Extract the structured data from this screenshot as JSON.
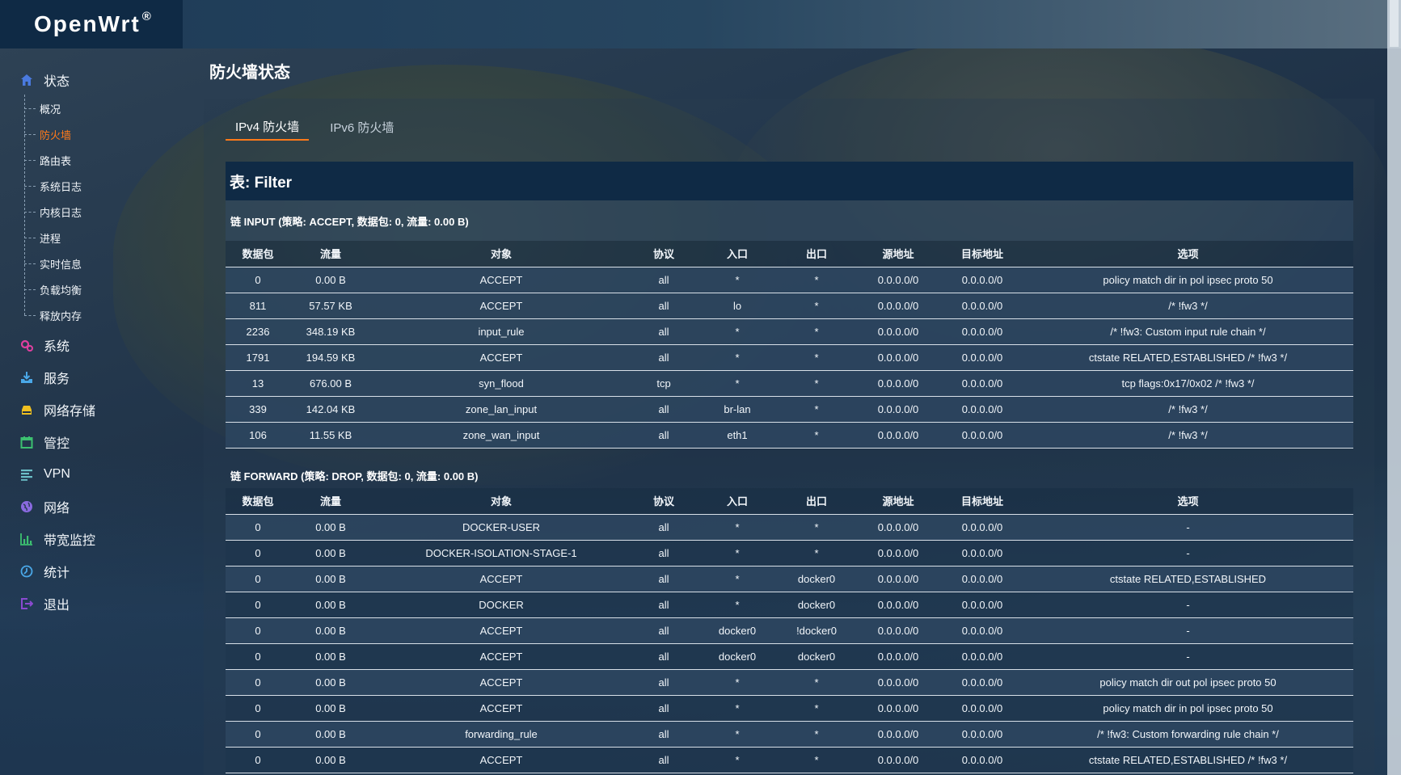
{
  "brand": {
    "name": "OpenWrt",
    "mark": "®"
  },
  "sidebar": {
    "status": {
      "label": "状态",
      "icon": "home-icon"
    },
    "status_items": [
      {
        "label": "概况",
        "active": false
      },
      {
        "label": "防火墙",
        "active": true
      },
      {
        "label": "路由表",
        "active": false
      },
      {
        "label": "系统日志",
        "active": false
      },
      {
        "label": "内核日志",
        "active": false
      },
      {
        "label": "进程",
        "active": false
      },
      {
        "label": "实时信息",
        "active": false
      },
      {
        "label": "负载均衡",
        "active": false
      },
      {
        "label": "释放内存",
        "active": false
      }
    ],
    "menus": [
      {
        "label": "系统",
        "icon": "gears-icon",
        "color": "#e040a0"
      },
      {
        "label": "服务",
        "icon": "download-tray-icon",
        "color": "#4aa8e8"
      },
      {
        "label": "网络存储",
        "icon": "disk-icon",
        "color": "#f0c020"
      },
      {
        "label": "管控",
        "icon": "calendar-icon",
        "color": "#3cc070"
      },
      {
        "label": "VPN",
        "icon": "list-icon",
        "color": "#6cc0c8"
      },
      {
        "label": "网络",
        "icon": "globe-icon",
        "color": "#8a6ae0"
      },
      {
        "label": "带宽监控",
        "icon": "bar-chart-icon",
        "color": "#3cc070"
      },
      {
        "label": "统计",
        "icon": "clock-icon",
        "color": "#4aa8e8"
      },
      {
        "label": "退出",
        "icon": "logout-icon",
        "color": "#8a4ad0"
      }
    ]
  },
  "page": {
    "title": "防火墙状态",
    "tabs": [
      {
        "label": "IPv4 防火墙",
        "active": true
      },
      {
        "label": "IPv6 防火墙",
        "active": false
      }
    ],
    "table_title": "表: Filter"
  },
  "columns": [
    "数据包",
    "流量",
    "对象",
    "协议",
    "入口",
    "出口",
    "源地址",
    "目标地址",
    "选项"
  ],
  "chains": [
    {
      "title": "链 INPUT (策略: ACCEPT, 数据包: 0, 流量: 0.00 B)",
      "rows": [
        [
          "0",
          "0.00 B",
          "ACCEPT",
          "all",
          "*",
          "*",
          "0.0.0.0/0",
          "0.0.0.0/0",
          "policy match dir in pol ipsec proto 50"
        ],
        [
          "811",
          "57.57 KB",
          "ACCEPT",
          "all",
          "lo",
          "*",
          "0.0.0.0/0",
          "0.0.0.0/0",
          "/* !fw3 */"
        ],
        [
          "2236",
          "348.19 KB",
          "input_rule",
          "all",
          "*",
          "*",
          "0.0.0.0/0",
          "0.0.0.0/0",
          "/* !fw3: Custom input rule chain */"
        ],
        [
          "1791",
          "194.59 KB",
          "ACCEPT",
          "all",
          "*",
          "*",
          "0.0.0.0/0",
          "0.0.0.0/0",
          "ctstate RELATED,ESTABLISHED /* !fw3 */"
        ],
        [
          "13",
          "676.00 B",
          "syn_flood",
          "tcp",
          "*",
          "*",
          "0.0.0.0/0",
          "0.0.0.0/0",
          "tcp flags:0x17/0x02 /* !fw3 */"
        ],
        [
          "339",
          "142.04 KB",
          "zone_lan_input",
          "all",
          "br-lan",
          "*",
          "0.0.0.0/0",
          "0.0.0.0/0",
          "/* !fw3 */"
        ],
        [
          "106",
          "11.55 KB",
          "zone_wan_input",
          "all",
          "eth1",
          "*",
          "0.0.0.0/0",
          "0.0.0.0/0",
          "/* !fw3 */"
        ]
      ]
    },
    {
      "title": "链 FORWARD (策略: DROP, 数据包: 0, 流量: 0.00 B)",
      "rows": [
        [
          "0",
          "0.00 B",
          "DOCKER-USER",
          "all",
          "*",
          "*",
          "0.0.0.0/0",
          "0.0.0.0/0",
          "-"
        ],
        [
          "0",
          "0.00 B",
          "DOCKER-ISOLATION-STAGE-1",
          "all",
          "*",
          "*",
          "0.0.0.0/0",
          "0.0.0.0/0",
          "-"
        ],
        [
          "0",
          "0.00 B",
          "ACCEPT",
          "all",
          "*",
          "docker0",
          "0.0.0.0/0",
          "0.0.0.0/0",
          "ctstate RELATED,ESTABLISHED"
        ],
        [
          "0",
          "0.00 B",
          "DOCKER",
          "all",
          "*",
          "docker0",
          "0.0.0.0/0",
          "0.0.0.0/0",
          "-"
        ],
        [
          "0",
          "0.00 B",
          "ACCEPT",
          "all",
          "docker0",
          "!docker0",
          "0.0.0.0/0",
          "0.0.0.0/0",
          "-"
        ],
        [
          "0",
          "0.00 B",
          "ACCEPT",
          "all",
          "docker0",
          "docker0",
          "0.0.0.0/0",
          "0.0.0.0/0",
          "-"
        ],
        [
          "0",
          "0.00 B",
          "ACCEPT",
          "all",
          "*",
          "*",
          "0.0.0.0/0",
          "0.0.0.0/0",
          "policy match dir out pol ipsec proto 50"
        ],
        [
          "0",
          "0.00 B",
          "ACCEPT",
          "all",
          "*",
          "*",
          "0.0.0.0/0",
          "0.0.0.0/0",
          "policy match dir in pol ipsec proto 50"
        ],
        [
          "0",
          "0.00 B",
          "forwarding_rule",
          "all",
          "*",
          "*",
          "0.0.0.0/0",
          "0.0.0.0/0",
          "/* !fw3: Custom forwarding rule chain */"
        ],
        [
          "0",
          "0.00 B",
          "ACCEPT",
          "all",
          "*",
          "*",
          "0.0.0.0/0",
          "0.0.0.0/0",
          "ctstate RELATED,ESTABLISHED /* !fw3 */"
        ]
      ]
    }
  ]
}
